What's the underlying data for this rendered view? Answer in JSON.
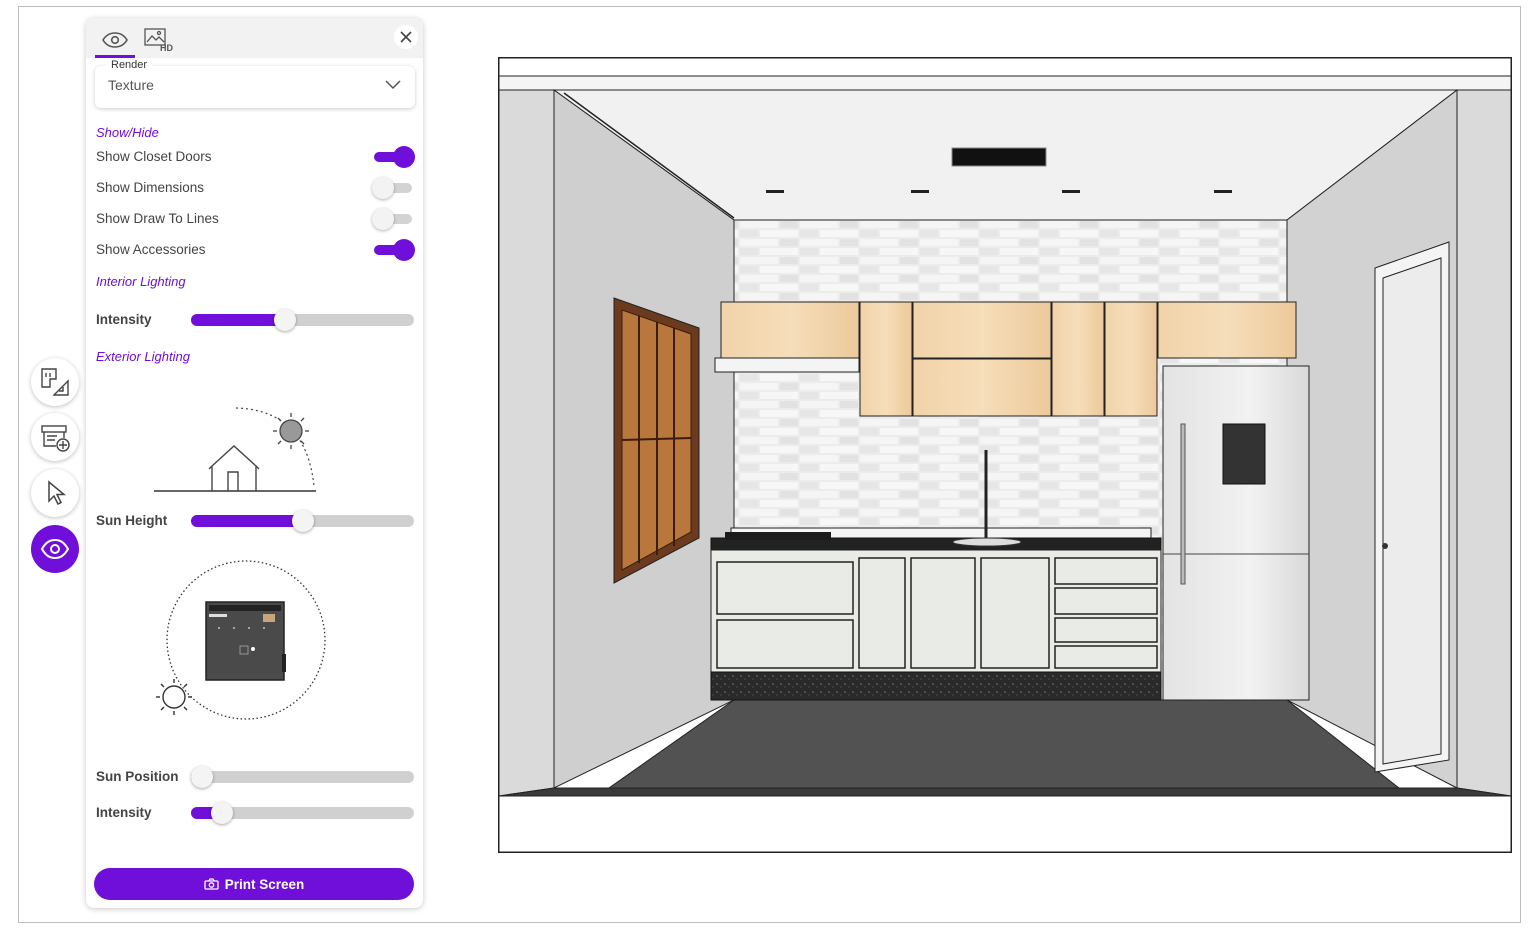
{
  "toolbar": {
    "items": [
      {
        "icon": "floorplan-measure-icon"
      },
      {
        "icon": "add-furniture-icon"
      },
      {
        "icon": "cursor-select-icon"
      },
      {
        "icon": "eye-icon",
        "active": true
      }
    ]
  },
  "panel": {
    "tabs": [
      {
        "icon": "eye-icon",
        "active": true
      },
      {
        "icon": "hd-image-icon",
        "active": false
      }
    ],
    "render": {
      "label": "Render",
      "value": "Texture"
    },
    "show_hide": {
      "title": "Show/Hide",
      "items": [
        {
          "label": "Show Closet Doors",
          "on": true
        },
        {
          "label": "Show Dimensions",
          "on": false
        },
        {
          "label": "Show Draw To Lines",
          "on": false
        },
        {
          "label": "Show Accessories",
          "on": true
        }
      ]
    },
    "interior_lighting": {
      "title": "Interior Lighting",
      "intensity_label": "Intensity",
      "intensity": 0.42
    },
    "exterior_lighting": {
      "title": "Exterior Lighting",
      "sun_height_label": "Sun Height",
      "sun_height": 0.5,
      "sun_position_label": "Sun Position",
      "sun_position": 0.05,
      "intensity_label": "Intensity",
      "intensity": 0.14
    },
    "print_label": "Print Screen"
  },
  "colors": {
    "accent": "#6f0fd9",
    "cabinet_wood": "#f3d9b4",
    "floor": "#505050",
    "wall_side": "#cfcfcf",
    "ceiling": "#f1f1f1"
  }
}
